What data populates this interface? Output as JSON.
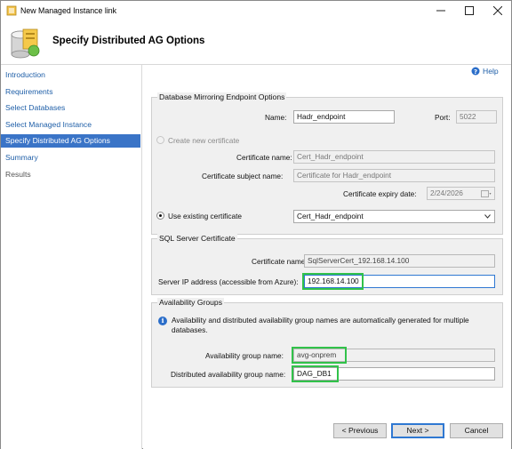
{
  "window": {
    "title": "New Managed Instance link"
  },
  "header": {
    "title": "Specify Distributed AG Options"
  },
  "sidebar": {
    "items": [
      {
        "label": "Introduction",
        "state": "link"
      },
      {
        "label": "Requirements",
        "state": "link"
      },
      {
        "label": "Select Databases",
        "state": "link"
      },
      {
        "label": "Select Managed Instance",
        "state": "link"
      },
      {
        "label": "Specify Distributed AG Options",
        "state": "active"
      },
      {
        "label": "Summary",
        "state": "link"
      },
      {
        "label": "Results",
        "state": "disabled"
      }
    ]
  },
  "help": {
    "label": "Help"
  },
  "endpoint": {
    "group_label": "Database Mirroring Endpoint Options",
    "name_label": "Name:",
    "name_value": "Hadr_endpoint",
    "port_label": "Port:",
    "port_value": "5022",
    "create_cert_label": "Create new certificate",
    "cert_name_label": "Certificate name:",
    "cert_name_value": "Cert_Hadr_endpoint",
    "cert_subject_label": "Certificate subject name:",
    "cert_subject_value": "Certificate for Hadr_endpoint",
    "expiry_label": "Certificate expiry date:",
    "expiry_value": "2/24/2026",
    "use_existing_label": "Use existing certificate",
    "existing_value": "Cert_Hadr_endpoint"
  },
  "sql_cert": {
    "group_label": "SQL Server Certificate",
    "cert_name_label": "Certificate name:",
    "cert_name_value": "SqlServerCert_192.168.14.100",
    "ip_label": "Server IP address (accessible from Azure):",
    "ip_value": "192.168.14.100"
  },
  "ag": {
    "group_label": "Availability Groups",
    "info_text": "Availability and distributed availability group names are automatically generated for multiple databases.",
    "ag_name_label": "Availability group name:",
    "ag_name_value": "avg-onprem",
    "dag_name_label": "Distributed availability group name:",
    "dag_name_value": "DAG_DB1"
  },
  "footer": {
    "previous_label": "< Previous",
    "next_label": "Next >",
    "cancel_label": "Cancel"
  },
  "colors": {
    "accent": "#3a74c7",
    "link": "#1f5fa8",
    "highlight_box": "#31c24a"
  }
}
